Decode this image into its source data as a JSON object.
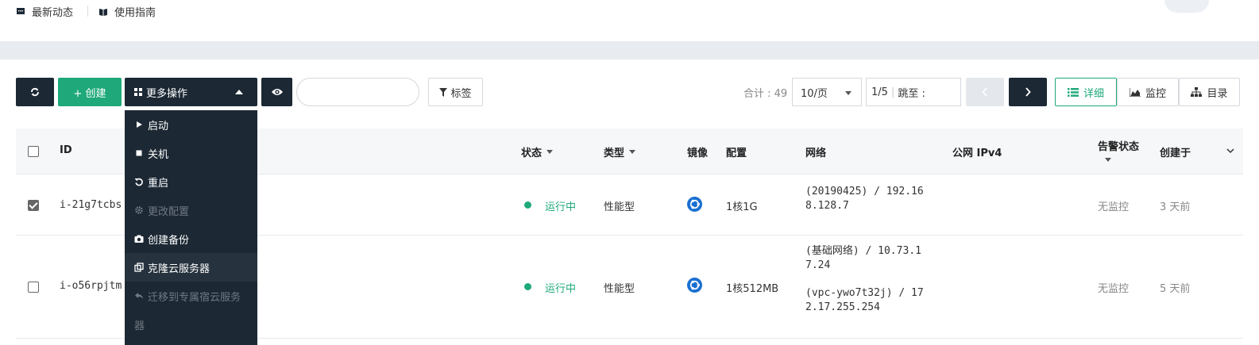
{
  "topbar": {
    "links": [
      {
        "label": "最新动态",
        "icon": "message-icon"
      },
      {
        "label": "使用指南",
        "icon": "book-icon"
      }
    ]
  },
  "toolbar": {
    "refresh_icon": "refresh-icon",
    "create_label": "+ 创建",
    "more_label": "更多操作",
    "tags_label": "标签",
    "search": {
      "value": "",
      "placeholder": ""
    },
    "total_label": "合计 : 49",
    "page_size": "10/页",
    "page_info": "1/5",
    "jump_label": "跳至 :",
    "view_buttons": [
      {
        "label": "详细",
        "icon": "list-icon",
        "active": true
      },
      {
        "label": "监控",
        "icon": "area-chart-icon",
        "active": false
      },
      {
        "label": "目录",
        "icon": "sitemap-icon",
        "active": false
      }
    ]
  },
  "more_menu": {
    "items": [
      {
        "label": "启动",
        "icon": "play-icon",
        "disabled": false
      },
      {
        "label": "关机",
        "icon": "stop-icon",
        "disabled": false
      },
      {
        "label": "重启",
        "icon": "restart-icon",
        "disabled": false
      },
      {
        "label": "更改配置",
        "icon": "gear-icon",
        "disabled": true
      },
      {
        "label": "创建备份",
        "icon": "camera-icon",
        "disabled": false
      },
      {
        "label": "克隆云服务器",
        "icon": "clone-icon",
        "disabled": false
      },
      {
        "label": "迁移到专属宿云服务",
        "label2": "器",
        "icon": "reply-icon",
        "disabled": true
      }
    ]
  },
  "table": {
    "columns": {
      "id": "ID",
      "status": "状态",
      "type": "类型",
      "image": "镜像",
      "config": "配置",
      "network": "网络",
      "ipv4": "公网 IPv4",
      "alarm": "告警状态",
      "created": "创建于"
    },
    "rows": [
      {
        "checked": true,
        "id": "i-21g7tcbs",
        "status": "运行中",
        "type": "性能型",
        "image_icon": "ubuntu-icon",
        "config": "1核1G",
        "network_lines": [
          "(20190425) / 192.16",
          "8.128.7"
        ],
        "alarm": "无监控",
        "created": "3 天前"
      },
      {
        "checked": false,
        "id": "i-o56rpjtm",
        "status": "运行中",
        "type": "性能型",
        "image_icon": "ubuntu-icon",
        "config": "1核512MB",
        "network_lines": [
          "(基础网络) / 10.73.1",
          "7.24",
          "(vpc-ywo7t32j) / 17",
          "2.17.255.254"
        ],
        "alarm": "无监控",
        "created": "5 天前"
      }
    ]
  },
  "colors": {
    "dark": "#1c2834",
    "green": "#1fa97a",
    "link": "#1a6fd1"
  }
}
